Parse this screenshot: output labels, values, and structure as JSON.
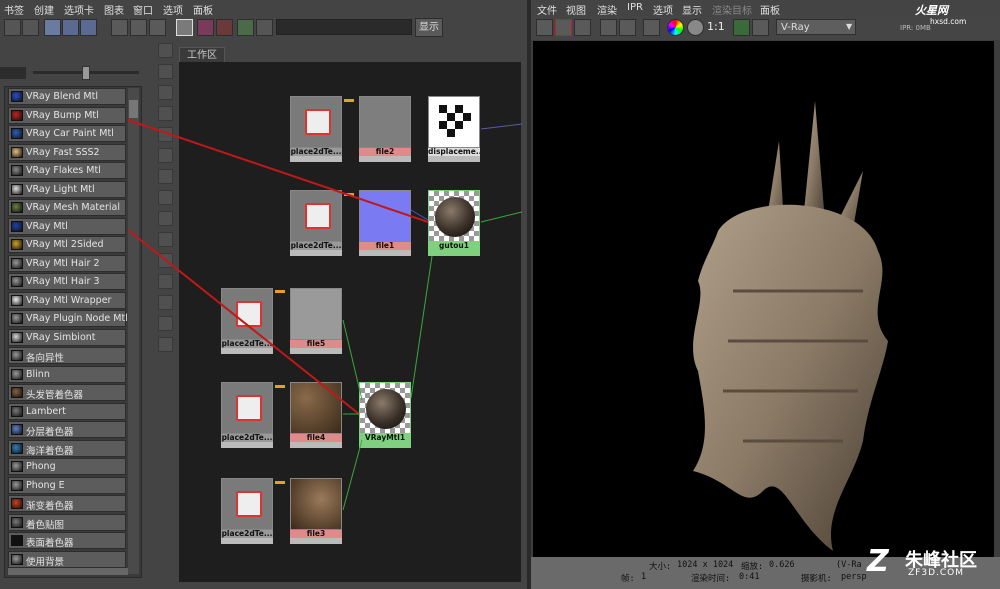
{
  "hypershade": {
    "menu": [
      "书签",
      "创建",
      "选项卡",
      "图表",
      "窗口",
      "选项",
      "面板"
    ],
    "search_button": "显示",
    "workspace_tab": "工作区",
    "materials": [
      {
        "label": "VRay Blend Mtl",
        "icon": "blend-mtl-icon",
        "color": "#2a4fd0"
      },
      {
        "label": "VRay Bump Mtl",
        "icon": "bump-mtl-icon",
        "color": "#c82020"
      },
      {
        "label": "VRay Car Paint Mtl",
        "icon": "car-paint-icon",
        "color": "#2a60c0"
      },
      {
        "label": "VRay Fast SSS2",
        "icon": "sss-icon",
        "color": "#e8c080"
      },
      {
        "label": "VRay Flakes Mtl",
        "icon": "flakes-icon",
        "color": "#8a8a8a"
      },
      {
        "label": "VRay Light Mtl",
        "icon": "light-mtl-icon",
        "color": "#e0e0e0"
      },
      {
        "label": "VRay Mesh Material",
        "icon": "mesh-material-icon",
        "color": "#6a8040"
      },
      {
        "label": "VRay Mtl",
        "icon": "vray-mtl-icon",
        "color": "#2040b0"
      },
      {
        "label": "VRay Mtl 2Sided",
        "icon": "two-sided-icon",
        "color": "#d0a020"
      },
      {
        "label": "VRay Mtl Hair 2",
        "icon": "hair-2-icon",
        "color": "#9a9a9a"
      },
      {
        "label": "VRay Mtl Hair 3",
        "icon": "hair-3-icon",
        "color": "#9a9a9a"
      },
      {
        "label": "VRay Mtl Wrapper",
        "icon": "wrapper-icon",
        "color": "#f0f0f0"
      },
      {
        "label": "VRay Plugin Node Mtl",
        "icon": "plugin-node-icon",
        "color": "#9a9a9a"
      },
      {
        "label": "VRay Simbiont",
        "icon": "simbiont-icon",
        "color": "#d8d8d8"
      },
      {
        "label": "各向异性",
        "icon": "anisotropic-icon",
        "color": "#9a9a9a"
      },
      {
        "label": "Blinn",
        "icon": "blinn-icon",
        "color": "#9a9a9a"
      },
      {
        "label": "头发管着色器",
        "icon": "hair-tube-icon",
        "color": "#8a6040"
      },
      {
        "label": "Lambert",
        "icon": "lambert-icon",
        "color": "#7a7a7a"
      },
      {
        "label": "分层着色器",
        "icon": "layered-shader-icon",
        "color": "#6080d0"
      },
      {
        "label": "海洋着色器",
        "icon": "ocean-shader-icon",
        "color": "#3080c0"
      },
      {
        "label": "Phong",
        "icon": "phong-icon",
        "color": "#9a9a9a"
      },
      {
        "label": "Phong E",
        "icon": "phong-e-icon",
        "color": "#9a9a9a"
      },
      {
        "label": "渐变着色器",
        "icon": "ramp-shader-icon",
        "color": "#d04020"
      },
      {
        "label": "着色贴图",
        "icon": "shading-map-icon",
        "color": "#7a7a7a"
      },
      {
        "label": "表面着色器",
        "icon": "surface-shader-icon",
        "color": "#111111"
      },
      {
        "label": "使用背景",
        "icon": "use-background-icon",
        "color": "#9a9a9a"
      }
    ],
    "nodes": {
      "place2d_a": "place2dTe...",
      "file2": "file2",
      "displacement": "displaceme...",
      "place2d_b": "place2dTe...",
      "file1": "file1",
      "gutou1": "gutou1",
      "place2d_c": "place2dTe...",
      "file5": "file5",
      "place2d_d": "place2dTe...",
      "file4": "file4",
      "vraymtl1": "VRayMtl1",
      "place2d_e": "place2dTe...",
      "file3": "file3"
    }
  },
  "render_view": {
    "menu": [
      "文件",
      "视图",
      "渲染",
      "IPR",
      "选项",
      "显示",
      "渲染目标",
      "面板"
    ],
    "ratio": "1:1",
    "renderer": "V-Ray",
    "status": {
      "size_label": "大小:",
      "size_value": "1024 x 1024",
      "zoom_label": "缩放:",
      "zoom_value": "0.626",
      "frame_label": "帧:",
      "frame_value": "1",
      "render_time_label": "渲染时间:",
      "render_time_value": "0:41",
      "camera_label": "摄影机:",
      "camera_value": "persp",
      "renderer_tag": "(V-Ra"
    },
    "ipr_text": "IPR: 0MB"
  },
  "watermarks": {
    "top_logo": "火星网",
    "top_logo_url": "hxsd.com",
    "bottom_logo": "朱峰社区",
    "bottom_logo_url": "ZF3D.COM",
    "bottom_logo_mark": "Z"
  },
  "colors": {
    "texture_node_label": "#e08b8b",
    "material_node_label": "#7fd17f",
    "connection_red": "#c01818",
    "connection_green": "#3aa83a",
    "connection_orange": "#e8a020"
  }
}
